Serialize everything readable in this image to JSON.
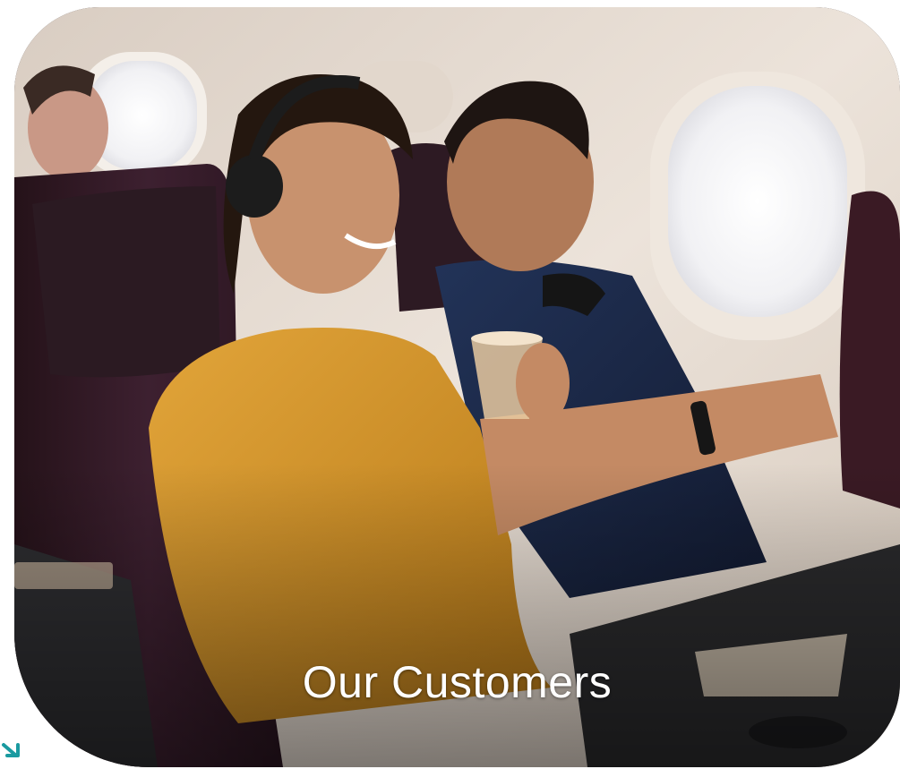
{
  "caption": {
    "title": "Our Customers"
  },
  "photo": {
    "subject": "passenger-photo",
    "icon": "image-icon"
  },
  "decoration": {
    "arrow_icon": "arrow-down-right-icon",
    "arrow_color": "#1a9aa0"
  },
  "colors": {
    "caption_text": "#ffffff",
    "seat": "#3a1e2a",
    "cabin_wall": "#e6dbd0",
    "blouse": "#d99a2e",
    "shirt": "#1c2a4a"
  }
}
